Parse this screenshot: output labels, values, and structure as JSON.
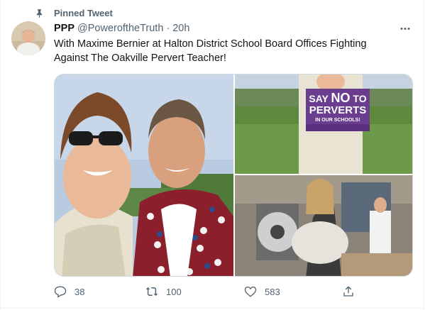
{
  "pinned_label": "Pinned Tweet",
  "author": {
    "name": "PPP",
    "handle": "@PoweroftheTruth",
    "time_separator": "·",
    "time": "20h"
  },
  "tweet_text_line1": "With Maxime Bernier at Halton District School Board Offices Fighting",
  "tweet_text_line2": "Against The Oakville Pervert Teacher!",
  "media": {
    "sign_line1_say": "SAY",
    "sign_line1_no": "NO",
    "sign_line1_to": "TO",
    "sign_line2": "PERVERTS",
    "sign_line3": "IN OUR SCHOOLS!"
  },
  "actions": {
    "reply_count": "38",
    "retweet_count": "100",
    "like_count": "583"
  },
  "colors": {
    "muted_text": "#536471",
    "sign_purple": "#6a3d8f",
    "border": "#cfd9de"
  },
  "icons": [
    "pin-icon",
    "more-icon",
    "reply-icon",
    "retweet-icon",
    "like-icon",
    "share-icon"
  ]
}
